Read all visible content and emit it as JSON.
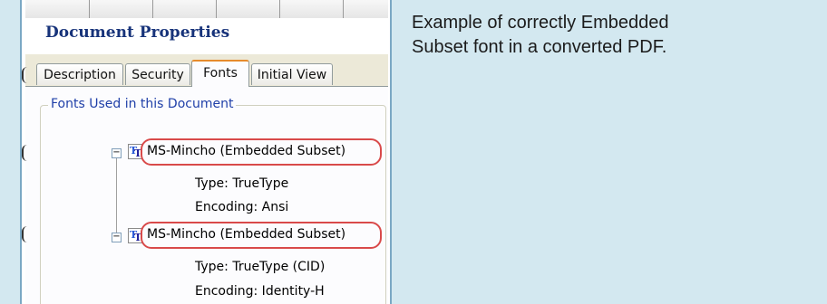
{
  "caption": {
    "line1": "Example of correctly Embedded",
    "line2": "Subset font in a converted PDF."
  },
  "dialog": {
    "title": "Document Properties",
    "tabs": [
      {
        "label": "Description",
        "active": false
      },
      {
        "label": "Security",
        "active": false
      },
      {
        "label": "Fonts",
        "active": true
      },
      {
        "label": "Initial View",
        "active": false
      }
    ],
    "group_label": "Fonts Used in this Document",
    "fonts": [
      {
        "name": "MS-Mincho (Embedded Subset)",
        "expander": "−",
        "icon": "truetype-font-icon",
        "type": "Type: TrueType",
        "encoding": "Encoding: Ansi",
        "highlighted": true
      },
      {
        "name": "MS-Mincho (Embedded Subset)",
        "expander": "−",
        "icon": "truetype-font-icon",
        "type": "Type: TrueType (CID)",
        "encoding": "Encoding: Identity-H",
        "highlighted": true
      }
    ]
  },
  "colors": {
    "caption_background": "#d3e8f0",
    "dialog_title": "#17337a",
    "group_label": "#1f3fa8",
    "highlight": "#d94a4a",
    "active_tab_accent": "#e68b2c"
  }
}
